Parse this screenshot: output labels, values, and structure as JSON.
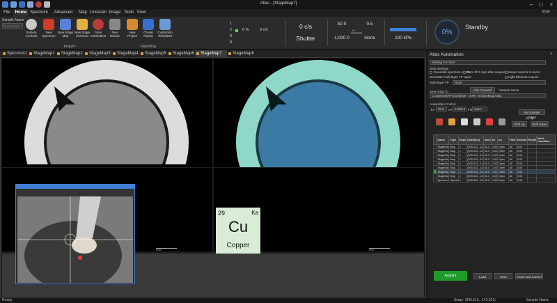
{
  "app": {
    "title": "Atlas - [StageMap7]",
    "style_label": "Style"
  },
  "ribbon_tabs": [
    "File",
    "Home",
    "Spectrum",
    "Advanced Quant",
    "Map",
    "Linescan",
    "Image",
    "Tools",
    "View"
  ],
  "ribbon": {
    "sample_name_label": "Sample Name",
    "sample_placeholder": "No Sample...",
    "buttons": [
      {
        "label": "System Controls",
        "icon": "gear-icon",
        "color": "#c8c8c8"
      },
      {
        "label": "New Spectrum",
        "icon": "spectrum-icon",
        "color": "#d03a2c"
      },
      {
        "label": "New Stage Map",
        "icon": "stage-map-icon",
        "color": "#5a7fd6"
      },
      {
        "label": "New Stage Linescan",
        "icon": "linescan-icon",
        "color": "#e0b040"
      },
      {
        "label": "Atlas Automation",
        "icon": "automation-icon",
        "color": "#b83a3a"
      },
      {
        "label": "New Mosaic",
        "icon": "mosaic-icon",
        "color": "#888888"
      },
      {
        "label": "New Project",
        "icon": "project-icon",
        "color": "#d48a2c"
      },
      {
        "label": "Create Report",
        "icon": "report-icon",
        "color": "#3a6fd0"
      },
      {
        "label": "Customize Templates",
        "icon": "templates-icon",
        "color": "#6a9ad8"
      }
    ],
    "group_acquire": "Acquire",
    "group_reporting": "Reporting",
    "detectors": [
      "1",
      "2",
      "3",
      "4"
    ],
    "det1_pct": "0 %",
    "det1_rate": "0 c/s",
    "rate": "0 c/s",
    "shutter": "Shutter",
    "kv": "50.0",
    "ua": "0.5",
    "kv_label": "kV",
    "ua_label": "uA",
    "size_label": "1,000.0",
    "filter": "None",
    "xray_small": "kV",
    "pressure": "100 kPa",
    "progress": "0%",
    "status": "Standby"
  },
  "doc_tabs": [
    "Spectrum1",
    "StageMap1",
    "StageMap2",
    "StageMap3",
    "StageMap4",
    "StageMap5",
    "StageMap6",
    "StageMap7",
    "StageMap8"
  ],
  "active_doc_tab": 7,
  "viewer": {
    "scale_left": "0mm",
    "scale_right": "0mm",
    "element": {
      "number": "29",
      "line": "Ka",
      "symbol": "Cu",
      "name": "Copper"
    }
  },
  "automation": {
    "title": "Atlas Automation",
    "status": "Waiting For Start",
    "data_settings": "Data Settings",
    "opt_spectrum_report": "Generate spectrum report",
    "opt_turn_off": "Turn off X-rays after acquisition",
    "opt_export_excel": "Export reports to excel",
    "opt_multilayer": "Generate multi-layer FP report",
    "opt_light_element": "Light Element Acquire",
    "multilayer_label": "Multi-layer FP",
    "multilayer_value": "None",
    "save_data_to": "Save Data To",
    "save_path": "C:\\Users\\IXRF\\OneDrive - IXRF, Inc\\Desktop\\Atlas",
    "also_connect": "Also Connect",
    "sample_name": "Sample Name",
    "acquisition_control": "Acquisition Control",
    "kv_label": "kV",
    "kv_value": "50.0",
    "ua_label": "uA",
    "ua_value": "1,000.0",
    "filter_label": "Filter",
    "filter_value": "Open",
    "set_sample_origin": "Set Sample Origin",
    "origin_value": "(0, 0)",
    "shift_up": "Shift Up",
    "shift_down": "Shift Down",
    "columns": [
      "",
      "Name",
      "Type",
      "Repeat",
      "Dwell(ms)",
      "Size(um)",
      "kV",
      "uA",
      "Filter",
      "Detector",
      "Height(mm)",
      "Multi Condition"
    ],
    "rows": [
      [
        "",
        "StageMap1",
        "Map",
        "1",
        "(905.513, -142.321)",
        "50.0",
        "1,000.0",
        "Open",
        "All",
        "0.00",
        ""
      ],
      [
        "",
        "StageMap2",
        "Map",
        "1",
        "(905.513, -142.321)",
        "50.0",
        "1,000.0",
        "Open",
        "All",
        "0.00",
        ""
      ],
      [
        "",
        "StageMap3",
        "Map",
        "1",
        "(905.513, -142.321)",
        "50.0",
        "1,000.0",
        "Open",
        "All",
        "0.00",
        ""
      ],
      [
        "",
        "StageMap4",
        "Map",
        "1",
        "(905.513, -142.321)",
        "50.0",
        "1,000.0",
        "Open",
        "All",
        "0.00",
        ""
      ],
      [
        "",
        "StageMap5",
        "Map",
        "1",
        "(905.513, -142.321)",
        "50.0",
        "1,000.0",
        "Open",
        "All",
        "0.00",
        ""
      ],
      [
        "",
        "StageMap6",
        "Map",
        "1",
        "(905.513, -142.321)",
        "50.0",
        "1,000.0",
        "Open",
        "All",
        "0.00",
        ""
      ],
      [
        "",
        "StageMap7",
        "Map",
        "1",
        "(905.513, -142.321)",
        "50.0",
        "1,000.0",
        "Open",
        "All",
        "0.00",
        ""
      ],
      [
        "",
        "StageMap8",
        "Map",
        "1",
        "(905.513, -142.321)",
        "50.0",
        "1,000.0",
        "Open",
        "All",
        "0.00",
        ""
      ],
      [
        "",
        "Spectrum",
        "Spectrum",
        "1",
        "(905.513, -142.321)",
        "50.0",
        "1,000.0",
        "Open",
        "All",
        "0.00",
        ""
      ]
    ],
    "btn_acquire": "Acquire",
    "btn_load": "Load",
    "btn_save": "Save",
    "btn_close": "Close and Cancel"
  },
  "status_bar": {
    "left": "Ready",
    "stage": "Stage: (905.513, -142.321)",
    "sample": "Sample Name:"
  },
  "colors": {
    "accent_blue": "#3f7fd8",
    "acquire_green": "#1e9a2a",
    "cu_panel": "#d9ecd6"
  }
}
